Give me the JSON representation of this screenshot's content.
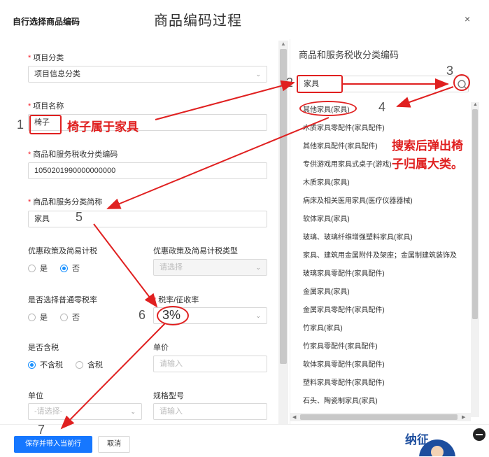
{
  "dialog": {
    "title": "自行选择商品编码",
    "close_label": "×"
  },
  "overlay_title": "商品编码过程",
  "form": {
    "project_category": {
      "label": "项目分类",
      "value": "项目信息分类"
    },
    "project_name": {
      "label": "项目名称",
      "value": "椅子"
    },
    "tax_code": {
      "label": "商品和服务税收分类编码",
      "value": "1050201990000000000"
    },
    "tax_short_name": {
      "label": "商品和服务分类简称",
      "value": "家具"
    },
    "preferential_policy": {
      "label": "优惠政策及简易计税",
      "options": [
        "是",
        "否"
      ],
      "selected": "否"
    },
    "preferential_type": {
      "label": "优惠政策及简易计税类型",
      "placeholder": "请选择"
    },
    "zero_rate": {
      "label": "是否选择普通零税率",
      "options": [
        "是",
        "否"
      ],
      "selected": ""
    },
    "tax_rate": {
      "label": "税率/征收率",
      "value": "3%"
    },
    "tax_included": {
      "label": "是否含税",
      "options": [
        "不含税",
        "含税"
      ],
      "selected": "不含税"
    },
    "unit_price": {
      "label": "单价",
      "placeholder": "请输入"
    },
    "unit": {
      "label": "单位",
      "placeholder": "-请选择-"
    },
    "spec": {
      "label": "规格型号",
      "placeholder": "请输入"
    }
  },
  "footer": {
    "save_label": "保存并带入当前行",
    "cancel_label": "取消"
  },
  "right": {
    "title": "商品和服务税收分类编码",
    "search_value": "家具",
    "items": [
      "其他家具(家具)",
      "木质家具零配件(家具配件)",
      "其他家具配件(家具配件)",
      "专供游戏用家具式桌子(游戏)",
      "木质家具(家具)",
      "病床及相关医用家具(医疗仪器器械)",
      "软体家具(家具)",
      "玻璃、玻璃纤维增强塑料家具(家具)",
      "家具、建筑用金属附件及架座；金属制建筑装饰及",
      "玻璃家具零配件(家具配件)",
      "金属家具(家具)",
      "金属家具零配件(家具配件)",
      "竹家具(家具)",
      "竹家具零配件(家具配件)",
      "软体家具零配件(家具配件)",
      "塑料家具零配件(家具配件)",
      "石头、陶瓷制家具(家具)"
    ]
  },
  "annotations": {
    "chair_note": "椅子属于家具",
    "search_note": "搜索后弹出椅子归属大类。",
    "steps": [
      "1",
      "2",
      "3",
      "4",
      "5",
      "6",
      "7"
    ]
  },
  "badge_text": "纳征",
  "colors": {
    "primary": "#1677ff",
    "annotation": "#e02020",
    "required": "#f5222d"
  }
}
